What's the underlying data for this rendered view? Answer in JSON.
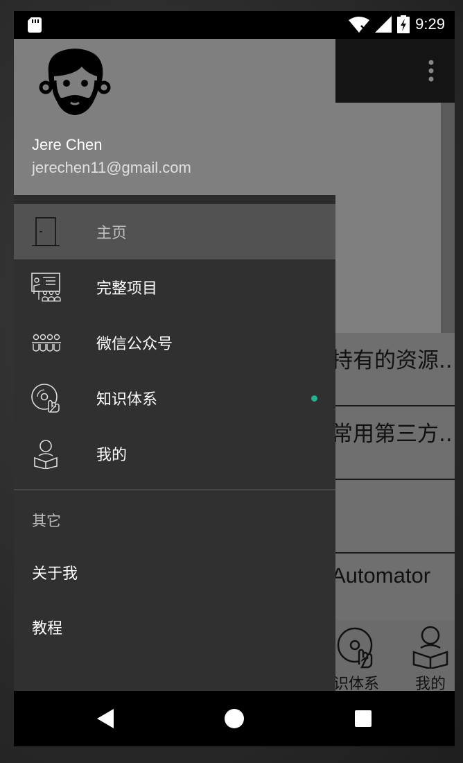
{
  "status_bar": {
    "time": "9:29"
  },
  "background_app": {
    "list_items": [
      "持有的资源..",
      "常用第三方...",
      "",
      "Automator"
    ],
    "bottom_nav": [
      {
        "label": "识体系",
        "icon": "disc-hand-icon"
      },
      {
        "label": "我的",
        "icon": "person-reading-icon"
      }
    ]
  },
  "drawer": {
    "user": {
      "name": "Jere Chen",
      "email": "jerechen11@gmail.com"
    },
    "items": [
      {
        "label": "主页",
        "icon": "door-icon",
        "active": true
      },
      {
        "label": "完整项目",
        "icon": "classroom-icon",
        "active": false
      },
      {
        "label": "微信公众号",
        "icon": "people-group-icon",
        "active": false
      },
      {
        "label": "知识体系",
        "icon": "disc-hand-icon",
        "active": false,
        "badge": true
      },
      {
        "label": "我的",
        "icon": "person-reading-icon",
        "active": false
      }
    ],
    "other_section": {
      "title": "其它",
      "items": [
        {
          "label": "关于我"
        },
        {
          "label": "教程"
        }
      ]
    }
  },
  "colors": {
    "drawer_bg": "#303030",
    "header_bg": "#7f7f7f",
    "active_bg": "#525252",
    "badge": "#1fb08c"
  }
}
